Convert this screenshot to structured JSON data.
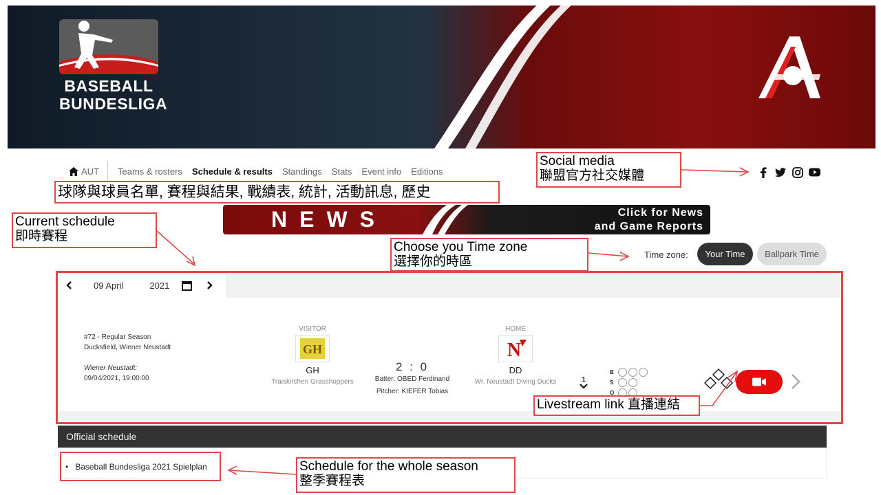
{
  "banner": {
    "logo_line1": "BASEBALL",
    "logo_line2": "BUNDESLIGA"
  },
  "nav": {
    "home_label": "AUT",
    "items": [
      "Teams & rosters",
      "Schedule & results",
      "Standings",
      "Stats",
      "Event info",
      "Editions"
    ],
    "active": "Schedule & results"
  },
  "social": [
    "facebook-icon",
    "twitter-icon",
    "instagram-icon",
    "youtube-icon"
  ],
  "annotations": {
    "nav_cn": "球隊與球員名單, 賽程與結果, 戰績表, 統計, 活動訊息, 歷史",
    "social_en": "Social media",
    "social_cn": "聯盟官方社交媒體",
    "current_en": "Current schedule",
    "current_cn": "即時賽程",
    "tz_en": "Choose you Time zone",
    "tz_cn": "選擇你的時區",
    "live_en": "Livestream link",
    "live_cn": "直播連結",
    "season_en": "Schedule for the whole season",
    "season_cn": "整季賽程表"
  },
  "news": {
    "big": "NEWS",
    "line1": "Click for News",
    "line2": "and Game Reports"
  },
  "timezone": {
    "label": "Time zone:",
    "your": "Your Time",
    "ballpark": "Ballpark Time"
  },
  "date": {
    "day": "09 April",
    "year": "2021"
  },
  "game": {
    "number": "#72 - Regular Season",
    "venue": "Ducksfield, Wiener Neustadt",
    "local_label": "Wiener Neustadt:",
    "local_time": "09/04/2021, 19:00:00",
    "visitor": {
      "role": "VISITOR",
      "abbr": "GH",
      "name": "Traiskirchen Grasshoppers"
    },
    "home": {
      "role": "HOME",
      "abbr": "DD",
      "name": "Wr. Neustadt Diving Ducks"
    },
    "score": "2 : 0",
    "batter": "Batter: OBED Ferdinand",
    "pitcher": "Pitcher: KIEFER Tobias",
    "inning": "1",
    "bso": [
      "B",
      "S",
      "O"
    ]
  },
  "official": {
    "title": "Official schedule",
    "link": "Baseball Bundesliga 2021 Spielplan"
  },
  "colors": {
    "annotation": "#e04848",
    "live": "#e50d0d",
    "banner_red": "#8a0f0f"
  }
}
